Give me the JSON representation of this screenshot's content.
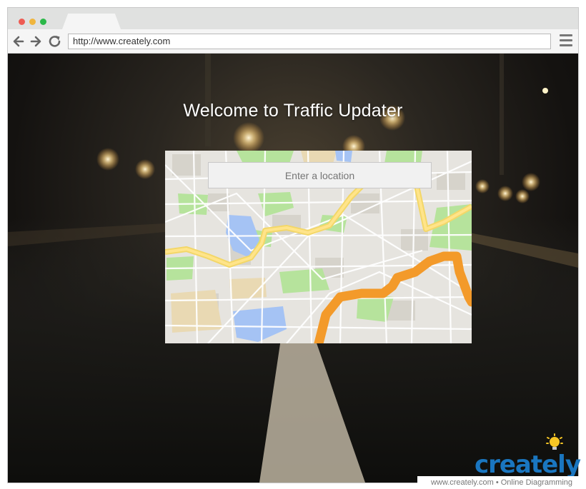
{
  "browser": {
    "url": "http://www.creately.com",
    "colors": {
      "close": "#ee5b52",
      "minimize": "#f0b53d",
      "maximize": "#2bb848"
    }
  },
  "page": {
    "heading": "Welcome to Traffic Updater",
    "search": {
      "placeholder": "Enter a location"
    }
  },
  "watermark": {
    "brand": "creately",
    "footer": "www.creately.com • Online Diagramming"
  }
}
